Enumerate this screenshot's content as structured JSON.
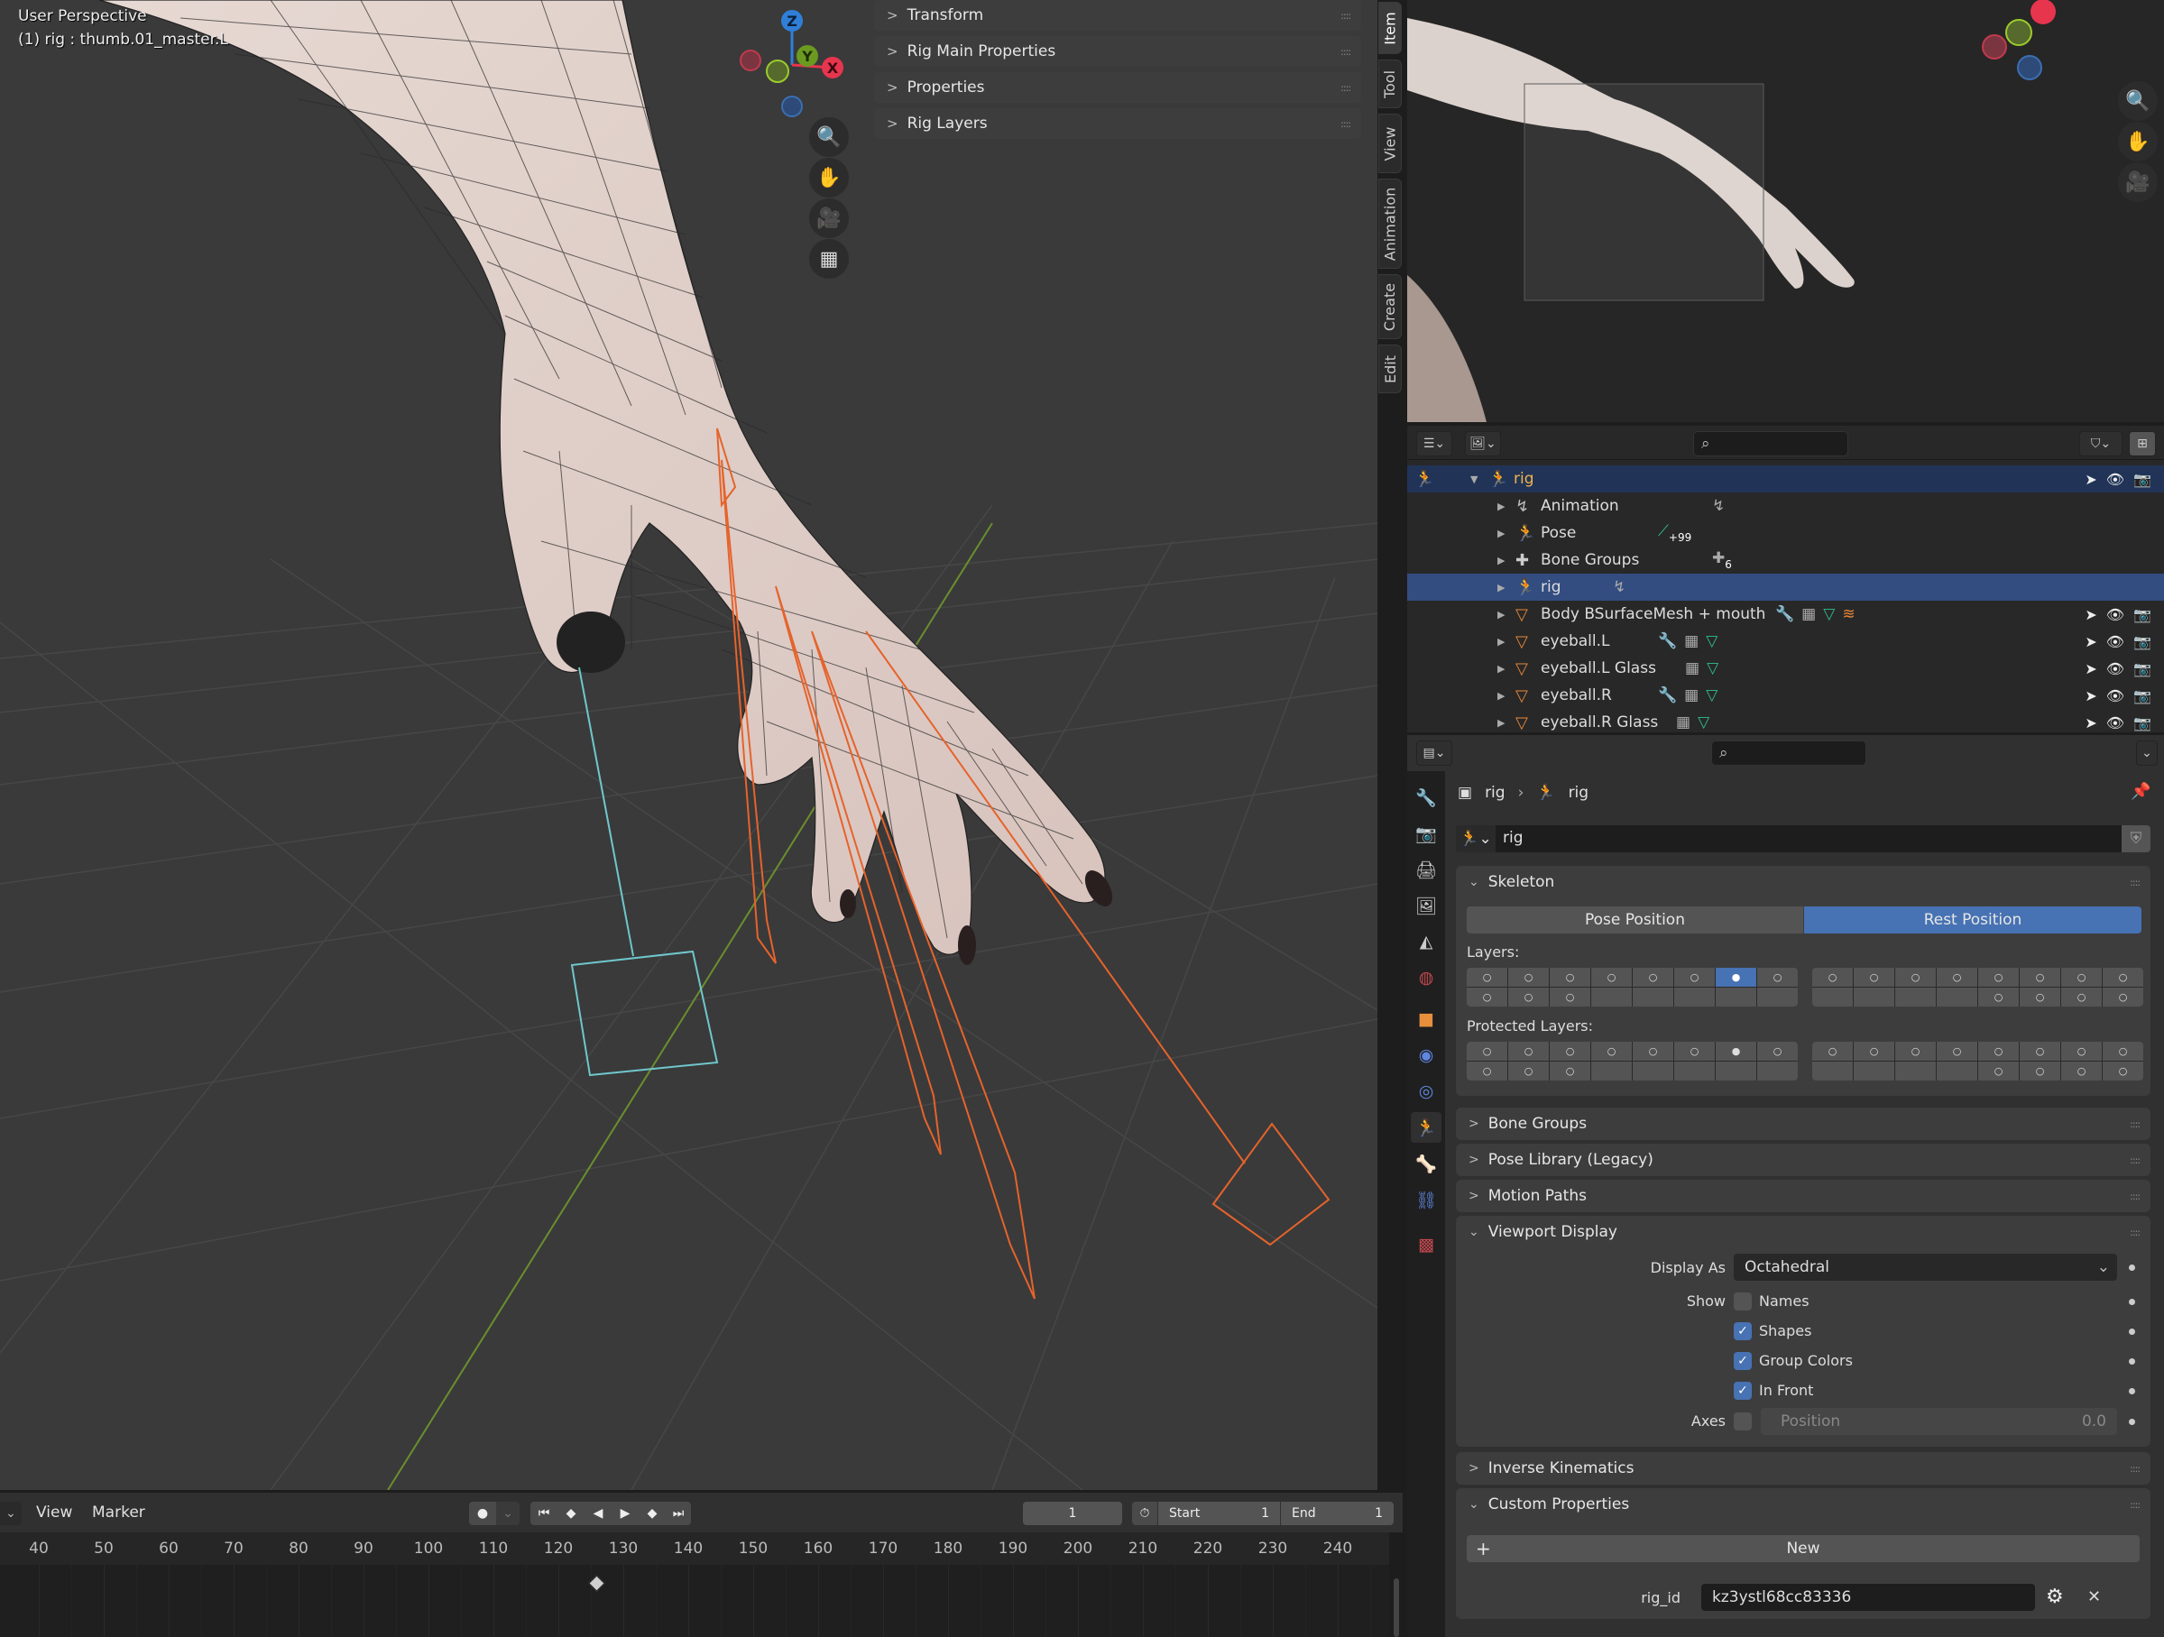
{
  "viewport": {
    "view_name": "User Perspective",
    "active_object": "(1) rig : thumb.01_master.L",
    "gizmo_axes": [
      {
        "label": "Z",
        "color": "#2f7fd8"
      },
      {
        "label": "Y",
        "color": "#6b9a20"
      },
      {
        "label": "X",
        "color": "#e8354e"
      }
    ],
    "nav_buttons": [
      "zoom-icon",
      "hand-pan-icon",
      "camera-icon",
      "grid-ortho-icon"
    ]
  },
  "npanel": {
    "sections": [
      {
        "label": "Transform",
        "expanded": false
      },
      {
        "label": "Rig Main Properties",
        "expanded": false
      },
      {
        "label": "Properties",
        "expanded": false
      },
      {
        "label": "Rig Layers",
        "expanded": false
      }
    ],
    "tabs": [
      {
        "label": "Item",
        "active": true
      },
      {
        "label": "Tool",
        "active": false
      },
      {
        "label": "View",
        "active": false
      },
      {
        "label": "Animation",
        "active": false
      },
      {
        "label": "Create",
        "active": false
      },
      {
        "label": "Edit",
        "active": false
      }
    ]
  },
  "outliner": {
    "search_placeholder": "",
    "rows": [
      {
        "label": "rig",
        "type": "armature-object",
        "level": 0,
        "expanded": true,
        "selected": "active",
        "extras": [],
        "visible": true
      },
      {
        "label": "Animation",
        "type": "animation",
        "level": 1,
        "extras": [
          "action-icon"
        ]
      },
      {
        "label": "Pose",
        "type": "pose",
        "level": 1,
        "extras": [
          "bone-icon"
        ],
        "extra_count": "+99"
      },
      {
        "label": "Bone Groups",
        "type": "bone-groups",
        "level": 1,
        "extras": [
          "bone-group-icon"
        ],
        "extra_count": "6"
      },
      {
        "label": "rig",
        "type": "armature-data",
        "level": 1,
        "selected": "selected",
        "extras": [
          "action-icon"
        ]
      },
      {
        "label": "Body BSurfaceMesh + mouth",
        "type": "mesh",
        "level": 1,
        "extras": [
          "wrench-icon",
          "vertex-group-icon",
          "mesh-data-icon",
          "particles-icon"
        ],
        "visible": true
      },
      {
        "label": "eyeball.L",
        "type": "mesh",
        "level": 1,
        "extras": [
          "wrench-icon",
          "vertex-group-icon",
          "mesh-data-icon"
        ],
        "visible": true
      },
      {
        "label": "eyeball.L  Glass",
        "type": "mesh",
        "level": 1,
        "extras": [
          "vertex-group-icon",
          "mesh-data-icon"
        ],
        "visible": true
      },
      {
        "label": "eyeball.R",
        "type": "mesh",
        "level": 1,
        "extras": [
          "wrench-icon",
          "vertex-group-icon",
          "mesh-data-icon"
        ],
        "visible": true
      },
      {
        "label": "eyeball.R Glass",
        "type": "mesh",
        "level": 1,
        "extras": [
          "vertex-group-icon",
          "mesh-data-icon"
        ],
        "visible": true
      }
    ]
  },
  "properties": {
    "search_placeholder": "",
    "breadcrumb": [
      "rig",
      "rig"
    ],
    "datablock_name": "rig",
    "skeleton": {
      "title": "Skeleton",
      "pose_position_label": "Pose Position",
      "rest_position_label": "Rest Position",
      "active_position": "Rest Position",
      "layers_label": "Layers:",
      "protected_layers_label": "Protected Layers:",
      "layers_active": [
        6
      ],
      "protected_active": [
        6
      ]
    },
    "collapsed_panels": [
      "Bone Groups",
      "Pose Library (Legacy)",
      "Motion Paths"
    ],
    "viewport_display": {
      "title": "Viewport Display",
      "display_as_label": "Display As",
      "display_as_value": "Octahedral",
      "show_label": "Show",
      "show_options": [
        {
          "label": "Names",
          "checked": false
        },
        {
          "label": "Shapes",
          "checked": true
        },
        {
          "label": "Group Colors",
          "checked": true
        },
        {
          "label": "In Front",
          "checked": true
        }
      ],
      "axes_label": "Axes",
      "axes_checked": false,
      "axes_position_label": "Position",
      "axes_position_value": "0.0"
    },
    "inverse_kinematics_title": "Inverse Kinematics",
    "custom_properties": {
      "title": "Custom Properties",
      "new_label": "New",
      "items": [
        {
          "name": "rig_id",
          "value": "kz3ystl68cc83336"
        }
      ]
    },
    "tabs": [
      "tool-icon",
      "render-icon",
      "output-icon",
      "view-layer-icon",
      "scene-icon",
      "world-icon",
      "object-icon",
      "modifiers-icon",
      "physics-icon",
      "object-data-armature-icon",
      "bone-icon",
      "bone-constraint-icon",
      "texture-icon"
    ],
    "active_tab": "object-data-armature-icon"
  },
  "timeline": {
    "menu": [
      "View",
      "Marker"
    ],
    "current_frame": "1",
    "start_label": "Start",
    "start_value": "1",
    "end_label": "End",
    "end_value": "1",
    "ruler_ticks": [
      "40",
      "50",
      "60",
      "70",
      "80",
      "90",
      "100",
      "110",
      "120",
      "130",
      "140",
      "150",
      "160",
      "170",
      "180",
      "190",
      "200",
      "210",
      "220",
      "230",
      "240"
    ],
    "keyframe_at": 126
  }
}
